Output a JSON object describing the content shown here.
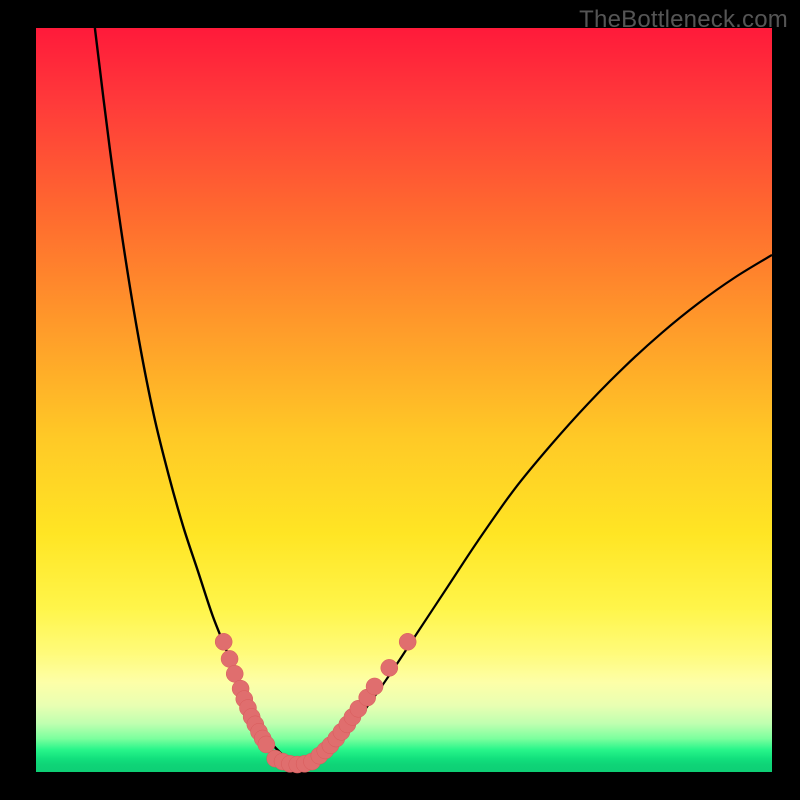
{
  "watermark": "TheBottleneck.com",
  "colors": {
    "page_bg": "#000000",
    "gradient_top": "#ff1a3a",
    "gradient_bottom": "#0ecf75",
    "curve": "#000000",
    "dots": "#e06e6e"
  },
  "chart_data": {
    "type": "line",
    "title": "",
    "xlabel": "",
    "ylabel": "",
    "xlim": [
      0,
      100
    ],
    "ylim": [
      0,
      100
    ],
    "grid": false,
    "series": [
      {
        "name": "curve-left",
        "x": [
          8,
          10,
          12,
          14,
          16,
          18,
          20,
          22,
          24,
          26,
          27,
          28,
          29,
          30,
          31,
          32,
          33,
          34,
          35
        ],
        "y": [
          100,
          84,
          70,
          58,
          48,
          40,
          33,
          27,
          21,
          16,
          13,
          10.5,
          8.3,
          6.5,
          5,
          3.8,
          2.8,
          1.8,
          1
        ]
      },
      {
        "name": "curve-right",
        "x": [
          35,
          37,
          40,
          44,
          48,
          52,
          56,
          60,
          65,
          70,
          75,
          80,
          85,
          90,
          95,
          100
        ],
        "y": [
          1,
          1.4,
          3.2,
          7.5,
          13,
          19,
          25,
          31,
          38,
          44,
          49.5,
          54.5,
          59,
          63,
          66.5,
          69.5
        ]
      }
    ],
    "scatter": [
      {
        "name": "dots-left",
        "x": [
          25.5,
          26.3,
          27.0,
          27.8,
          28.3,
          28.8,
          29.3,
          29.8,
          30.3,
          30.8,
          31.3
        ],
        "y": [
          17.5,
          15.2,
          13.2,
          11.2,
          9.8,
          8.6,
          7.4,
          6.4,
          5.4,
          4.5,
          3.7
        ]
      },
      {
        "name": "dots-bottom",
        "x": [
          32.5,
          33.5,
          34.5,
          35.5,
          36.5,
          37.5
        ],
        "y": [
          1.8,
          1.4,
          1.1,
          1.0,
          1.1,
          1.4
        ]
      },
      {
        "name": "dots-right",
        "x": [
          38.5,
          39.3,
          40.0,
          40.8,
          41.5,
          42.3,
          43.0,
          43.8,
          45.0,
          46.0,
          48.0
        ],
        "y": [
          2.2,
          2.9,
          3.6,
          4.5,
          5.4,
          6.4,
          7.4,
          8.5,
          10.0,
          11.5,
          14.0
        ]
      },
      {
        "name": "dots-upper-right",
        "x": [
          50.5
        ],
        "y": [
          17.5
        ]
      }
    ]
  }
}
